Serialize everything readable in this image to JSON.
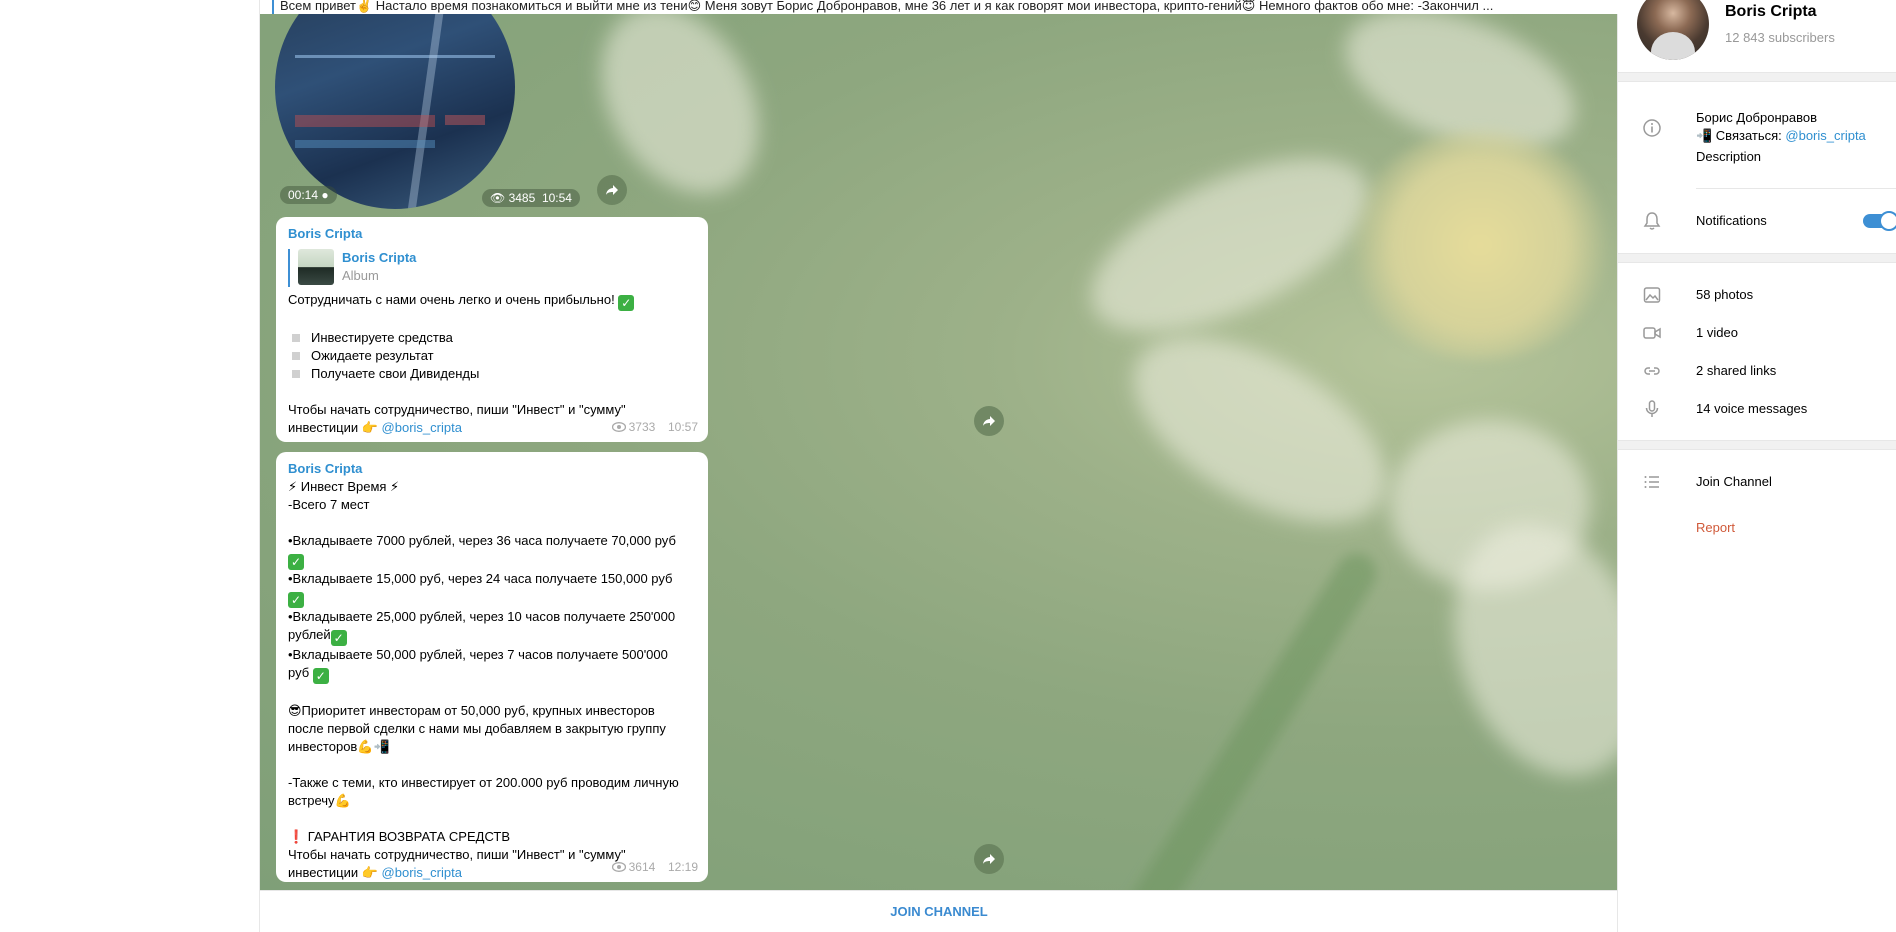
{
  "pinned": {
    "text": "Всем привет✌️ Настало время познакомиться и выйти мне из тени😊 Меня зовут Борис Добронравов, мне 36 лет и я как говорят мои инвестора, крипто-гений😇 Немного фактов обо мне: -Закончил ..."
  },
  "video": {
    "duration": "00:14",
    "views": "3485",
    "time": "10:54"
  },
  "post1": {
    "author": "Boris Cripta",
    "fwd_title": "Boris Cripta",
    "fwd_sub": "Album",
    "headline": "Сотрудничать с нами очень легко и очень прибыльно!",
    "bullets": [
      "Инвестируете средства",
      "Ожидаете результат",
      "Получаете свои Дивиденды"
    ],
    "cta_line1": "Чтобы начать сотрудничество, пиши \"Инвест\" и \"сумму\"",
    "cta_line2_prefix": "инвестиции 👉 ",
    "cta_link": "@boris_cripta",
    "views": "3733",
    "time": "10:57"
  },
  "post2": {
    "author": "Boris Cripta",
    "l1": "⚡ Инвест Время  ⚡",
    "l2": "-Всего 7 мест",
    "o1a": "•Вкладываете 7000 рублей, через 36 часа получаете 70,000 руб",
    "o2a": "•Вкладываете 15,000 руб, через 24 часа получаете 150,000 руб",
    "o3a": "•Вкладываете 25,000 рублей, через 10 часов получаете 250'000",
    "o3b": "рублей",
    "o4a": "•Вкладываете 50,000 рублей, через 7 часов получаете 500'000",
    "o4b": "руб",
    "p1": "😎Приоритет инвесторам от 50,000 руб, крупных инвесторов",
    "p2": "после первой сделки с нами мы добавляем в закрытую группу",
    "p3": "инвесторов💪📲",
    "q1": "-Также с теми, кто инвестирует от 200.000 руб проводим личную",
    "q2": "встречу💪",
    "g1": "❗ ГАРАНТИЯ ВОЗВРАТА СРЕДСТВ",
    "cta_line1": "Чтобы начать сотрудничество, пиши \"Инвест\" и \"сумму\"",
    "cta_line2_prefix": "инвестиции 👉 ",
    "cta_link": "@boris_cripta",
    "views": "3614",
    "time": "12:19"
  },
  "join_label": "JOIN CHANNEL",
  "panel": {
    "name": "Boris Cripta",
    "subscribers": "12 843 subscribers",
    "info_line1": "Борис Добронравов",
    "info_line2_prefix": "📲 Связаться: ",
    "info_link": "@boris_cripta",
    "info_sub": "Description",
    "notifications": "Notifications",
    "photos": "58 photos",
    "video": "1 video",
    "links": "2 shared links",
    "voice": "14 voice messages",
    "join": "Join Channel",
    "report": "Report"
  },
  "colors": {
    "accent": "#3d8fd4",
    "link": "#2f8fd0",
    "report": "#d05a3a"
  }
}
